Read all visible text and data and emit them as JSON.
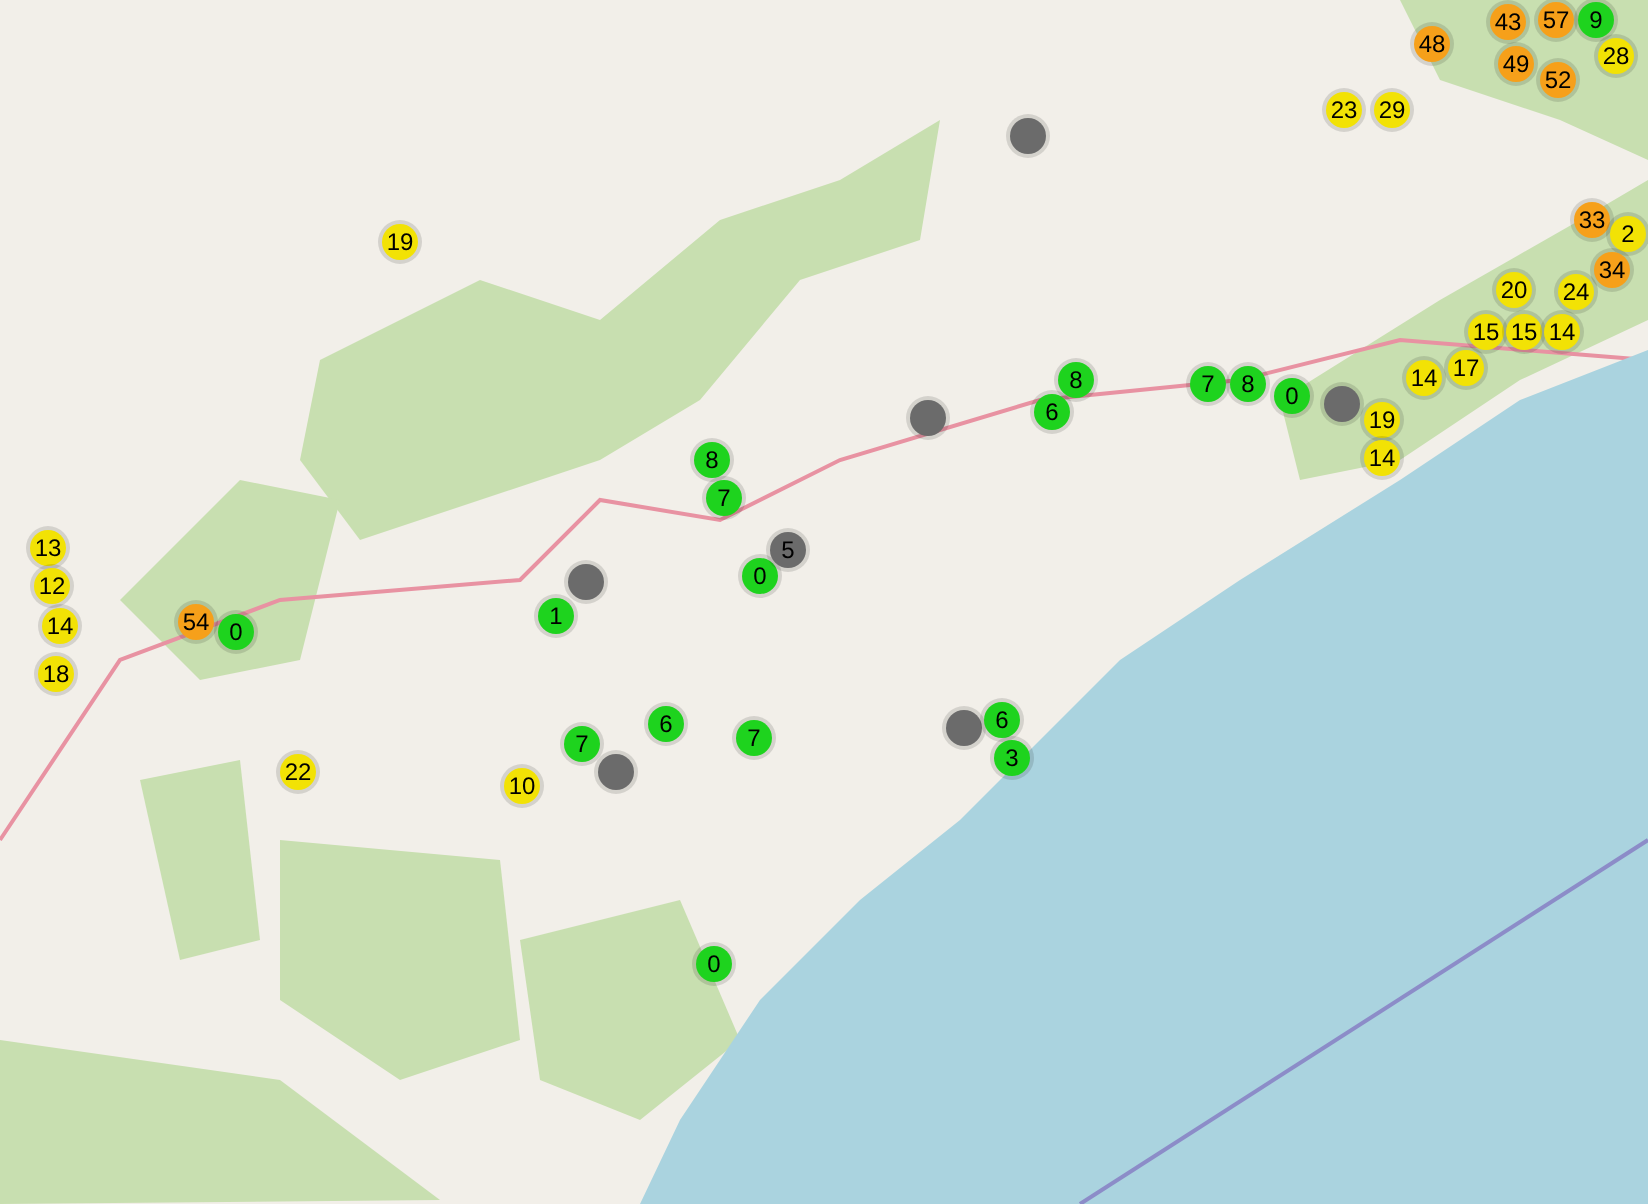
{
  "markers": [
    {
      "label": "48",
      "color": "#f6a01a"
    },
    {
      "label": "43",
      "color": "#f6a01a"
    },
    {
      "label": "57",
      "color": "#f6a01a"
    },
    {
      "label": "49",
      "color": "#f6a01a"
    },
    {
      "label": "52",
      "color": "#f6a01a"
    },
    {
      "label": "9",
      "color": "#1ed31e"
    },
    {
      "label": "28",
      "color": "#f2e205"
    },
    {
      "label": "23",
      "color": "#f2e205"
    },
    {
      "label": "29",
      "color": "#f2e205"
    },
    {
      "label": "33",
      "color": "#f6a01a"
    },
    {
      "label": "2",
      "color": "#f2e205"
    },
    {
      "label": "34",
      "color": "#f6a01a"
    },
    {
      "label": "20",
      "color": "#f2e205"
    },
    {
      "label": "24",
      "color": "#f2e205"
    },
    {
      "label": "15",
      "color": "#f2e205"
    },
    {
      "label": "15",
      "color": "#f2e205"
    },
    {
      "label": "14",
      "color": "#f2e205"
    },
    {
      "label": "17",
      "color": "#f2e205"
    },
    {
      "label": "14",
      "color": "#f2e205"
    },
    {
      "label": "19",
      "color": "#f2e205"
    },
    {
      "label": "14",
      "color": "#f2e205"
    },
    {
      "color": "#6b6b6b"
    },
    {
      "color": "#6b6b6b"
    },
    {
      "color": "#6b6b6b"
    },
    {
      "color": "#6b6b6b"
    },
    {
      "color": "#6b6b6b"
    },
    {
      "color": "#6b6b6b"
    },
    {
      "label": "13",
      "color": "#f2e205"
    },
    {
      "label": "12",
      "color": "#f2e205"
    },
    {
      "label": "14",
      "color": "#f2e205"
    },
    {
      "label": "18",
      "color": "#f2e205"
    },
    {
      "label": "54",
      "color": "#f6a01a"
    },
    {
      "label": "0",
      "color": "#1ed31e"
    },
    {
      "label": "19",
      "color": "#f2e205"
    },
    {
      "label": "22",
      "color": "#f2e205"
    },
    {
      "label": "10",
      "color": "#f2e205"
    },
    {
      "label": "8",
      "color": "#1ed31e"
    },
    {
      "label": "7",
      "color": "#1ed31e"
    },
    {
      "label": "8",
      "color": "#1ed31e"
    },
    {
      "label": "6",
      "color": "#1ed31e"
    },
    {
      "label": "7",
      "color": "#1ed31e"
    },
    {
      "label": "8",
      "color": "#1ed31e"
    },
    {
      "label": "0",
      "color": "#1ed31e"
    },
    {
      "label": "0",
      "color": "#1ed31e"
    },
    {
      "label": "5",
      "color": "#6b6b6b"
    },
    {
      "label": "1",
      "color": "#1ed31e"
    },
    {
      "label": "6",
      "color": "#1ed31e"
    },
    {
      "label": "7",
      "color": "#1ed31e"
    },
    {
      "label": "7",
      "color": "#1ed31e"
    },
    {
      "label": "6",
      "color": "#1ed31e"
    },
    {
      "label": "3",
      "color": "#1ed31e"
    },
    {
      "label": "0",
      "color": "#1ed31e"
    }
  ]
}
